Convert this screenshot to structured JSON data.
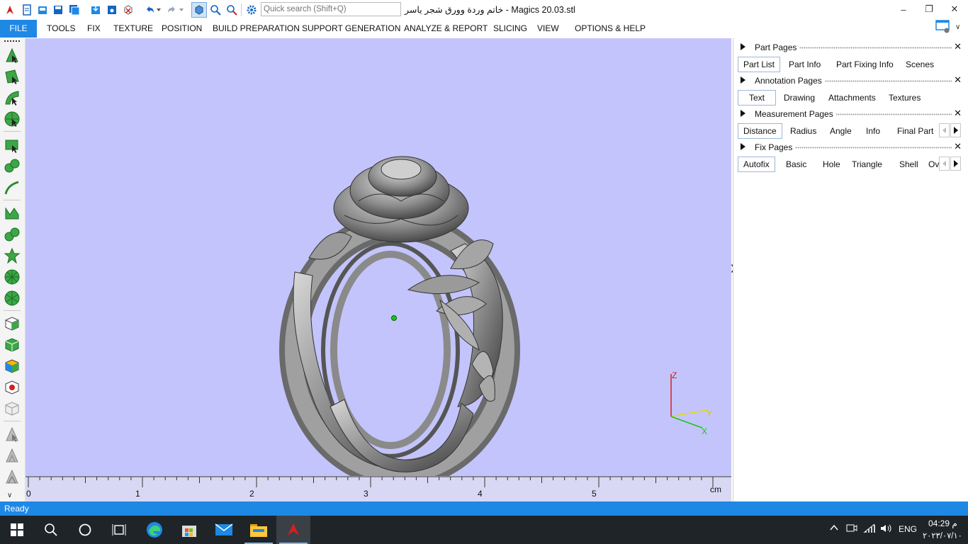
{
  "window": {
    "title": "خاتم وردة وورق شجر ياسر - Magics 20.03.stl",
    "search_placeholder": "Quick search (Shift+Q)"
  },
  "menu": [
    "FILE",
    "TOOLS",
    "FIX",
    "TEXTURE",
    "POSITION",
    "BUILD PREPARATION",
    "SUPPORT GENERATION",
    "ANALYZE & REPORT",
    "SLICING",
    "VIEW",
    "OPTIONS & HELP"
  ],
  "viewport": {
    "background": "#c4c4fc",
    "ruler_labels": [
      "0",
      "1",
      "2",
      "3",
      "4",
      "5"
    ],
    "ruler_unit": "cm",
    "axes": {
      "z": "Z",
      "y": "Y",
      "x": "X"
    }
  },
  "panel": {
    "part_pages": {
      "title": "Part Pages",
      "tabs": [
        "Part List",
        "Part Info",
        "Part Fixing Info",
        "Scenes"
      ],
      "active": 0
    },
    "annotation_pages": {
      "title": "Annotation Pages",
      "tabs": [
        "Text",
        "Drawing",
        "Attachments",
        "Textures"
      ],
      "active": 0
    },
    "measurement_pages": {
      "title": "Measurement Pages",
      "tabs": [
        "Distance",
        "Radius",
        "Angle",
        "Info",
        "Final Part"
      ],
      "active": 0
    },
    "fix_pages": {
      "title": "Fix Pages",
      "tabs": [
        "Autofix",
        "Basic",
        "Hole",
        "Triangle",
        "Shell",
        "Over"
      ],
      "active": 0
    }
  },
  "status": {
    "text": "Ready"
  },
  "taskbar": {
    "time": "04:29 م",
    "date": "٢٠٢٣/٠٧/١٠",
    "language": "ENG"
  },
  "colors": {
    "accent": "#1e88e5",
    "taskbar": "#1f2428",
    "toolbar_green": "#3aa845"
  }
}
